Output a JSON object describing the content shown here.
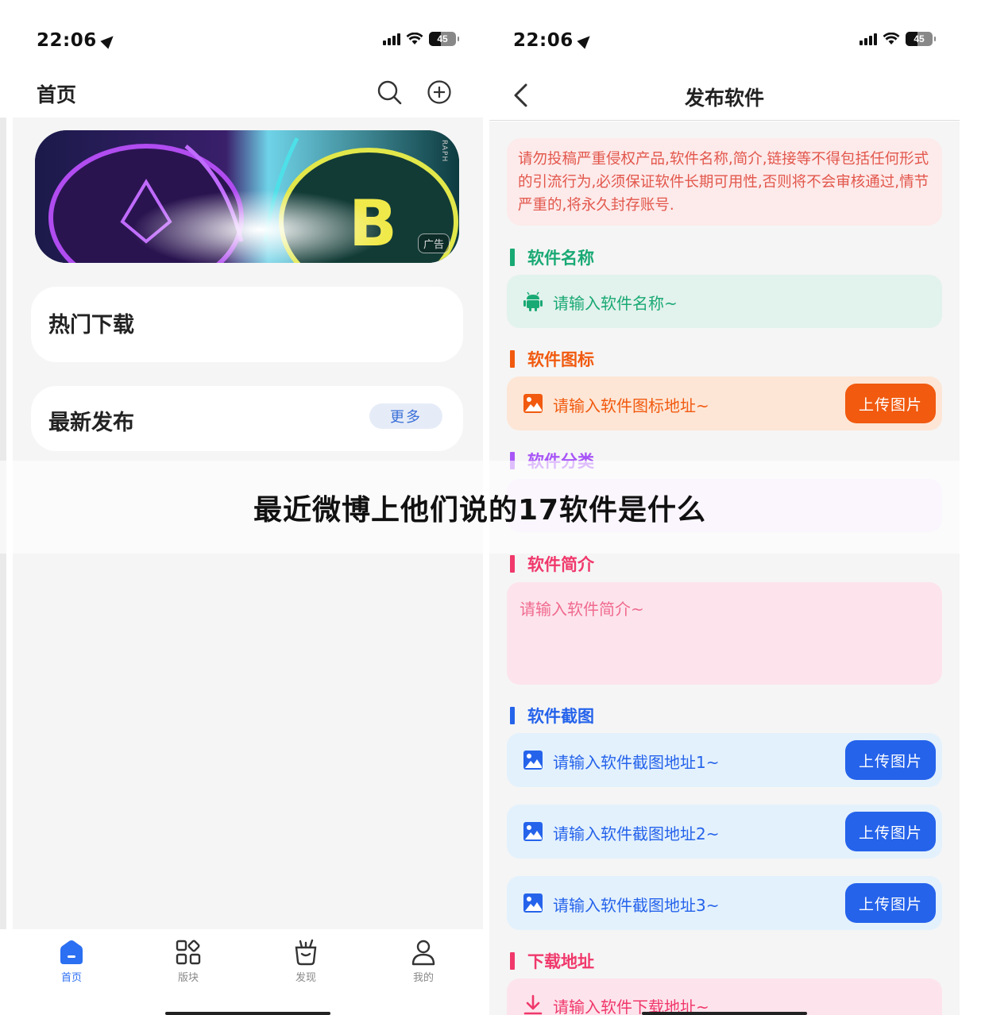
{
  "status_bar": {
    "time": "22:06",
    "battery": "45"
  },
  "left": {
    "title": "首页",
    "banner_ad_tag": "广告",
    "banner_side_text": "RAPH",
    "hot_title": "热门下载",
    "new_title": "最新发布",
    "more_label": "更多",
    "tabs": [
      {
        "label": "首页",
        "icon": "home-icon"
      },
      {
        "label": "版块",
        "icon": "grid-icon"
      },
      {
        "label": "发现",
        "icon": "discover-icon"
      },
      {
        "label": "我的",
        "icon": "user-icon"
      }
    ]
  },
  "right": {
    "title": "发布软件",
    "notice": "请勿投稿严重侵权产品,软件名称,简介,链接等不得包括任何形式的引流行为,必须保证软件长期可用性,否则将不会审核通过,情节严重的,将永久封存账号.",
    "sections": {
      "name": {
        "title": "软件名称",
        "placeholder": "请输入软件名称~"
      },
      "icon": {
        "title": "软件图标",
        "placeholder": "请输入软件图标地址~",
        "button": "上传图片"
      },
      "category": {
        "title": "软件分类"
      },
      "intro": {
        "title": "软件简介",
        "placeholder": "请输入软件简介~"
      },
      "screenshots": {
        "title": "软件截图",
        "placeholders": [
          "请输入软件截图地址1~",
          "请输入软件截图地址2~",
          "请输入软件截图地址3~"
        ],
        "button": "上传图片"
      },
      "download": {
        "title": "下载地址",
        "placeholder": "请输入软件下载地址~"
      }
    }
  },
  "overlay_caption": "最近微博上他们说的17软件是什么",
  "colors": {
    "green": "#19a974",
    "orange": "#f15a0f",
    "purple": "#a855f7",
    "pink": "#f0386b",
    "blue": "#2563eb",
    "tab_active": "#2b6ff2"
  }
}
